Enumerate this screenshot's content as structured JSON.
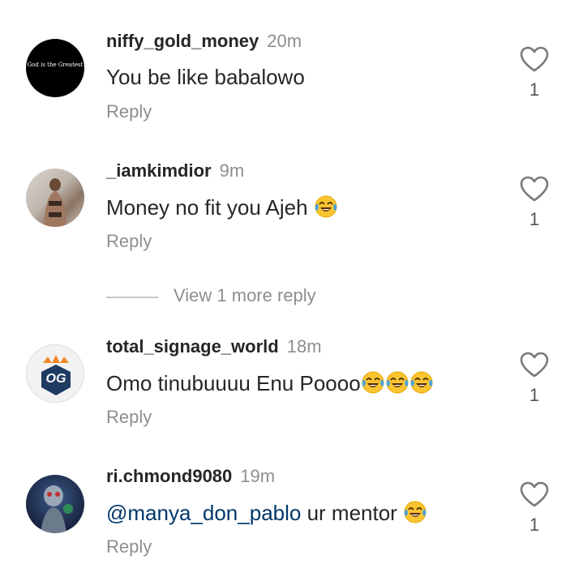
{
  "comments": [
    {
      "username": "niffy_gold_money",
      "time": "20m",
      "text": "You be like babalowo",
      "reply_label": "Reply",
      "likes": "1",
      "avatar_text": "God is the Greatest"
    },
    {
      "username": "_iamkimdior",
      "time": "9m",
      "text": "Money no fit you Ajeh",
      "reply_label": "Reply",
      "likes": "1"
    },
    {
      "username": "total_signage_world",
      "time": "18m",
      "text": "Omo tinubuuuu Enu Poooo",
      "reply_label": "Reply",
      "likes": "1",
      "avatar_text": "OG"
    },
    {
      "username": "ri.chmond9080",
      "time": "19m",
      "mention": "@manya_don_pablo",
      "text": " ur mentor",
      "reply_label": "Reply",
      "likes": "1"
    }
  ],
  "view_more": "View 1 more reply",
  "icons": {
    "like": "heart-outline-icon",
    "emoji": "face-with-tears-of-joy-emoji"
  },
  "colors": {
    "username": "#262626",
    "secondary": "#8e8e8e",
    "mention": "#00376b"
  }
}
